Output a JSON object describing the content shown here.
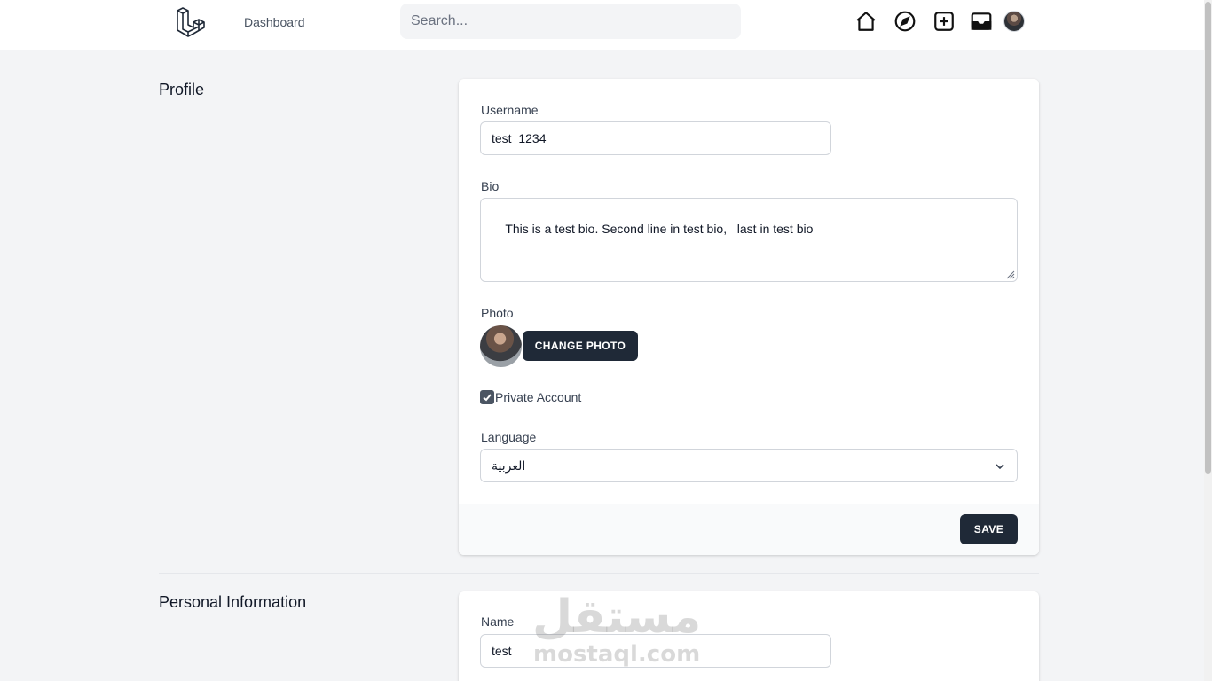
{
  "nav": {
    "dashboard_label": "Dashboard",
    "search_placeholder": "Search...",
    "icons": [
      "home-icon",
      "compass-icon",
      "plus-square-icon",
      "inbox-icon"
    ]
  },
  "profile": {
    "section_title": "Profile",
    "username_label": "Username",
    "username_value": "test_1234",
    "bio_label": "Bio",
    "bio_value": "This is a test bio. Second line in test bio,   last in test bio",
    "photo_label": "Photo",
    "change_photo_label": "CHANGE PHOTO",
    "private_account_label": "Private Account",
    "private_account_checked": true,
    "language_label": "Language",
    "language_value": "العربية",
    "save_label": "SAVE"
  },
  "personal": {
    "section_title": "Personal Information",
    "name_label": "Name",
    "name_value": "test"
  },
  "watermark": {
    "arabic": "مستقل",
    "latin": "mostaql.com"
  },
  "colors": {
    "button_bg": "#1f2937",
    "page_bg": "#f3f4f6"
  }
}
